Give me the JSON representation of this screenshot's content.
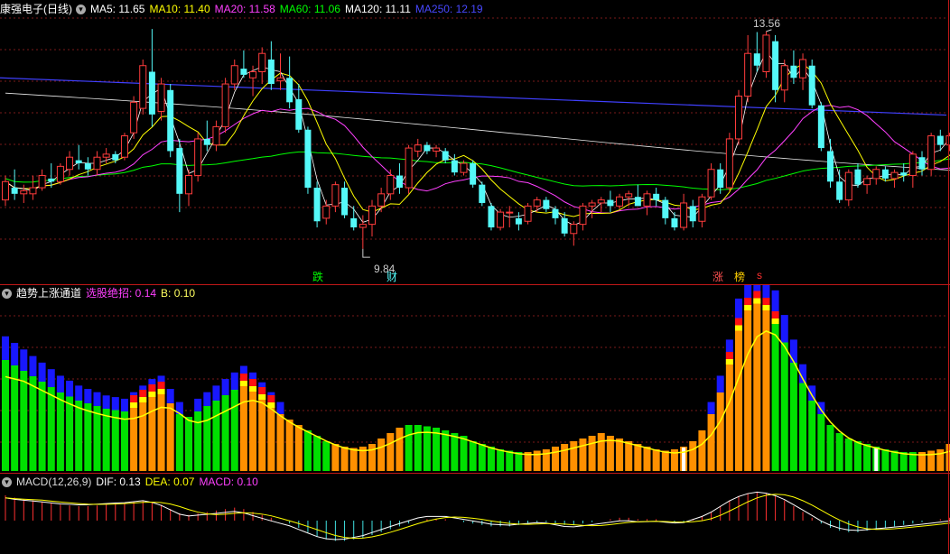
{
  "colors": {
    "up": "#ff3c3c",
    "down": "#54f8f8",
    "ma5": "#ffffff",
    "ma10": "#ffff00",
    "ma20": "#ff40ff",
    "ma60": "#00ff00",
    "ma120": "#ffffff",
    "ma250": "#4040ff",
    "grid": "#7a1a1a",
    "sep": "#c01818"
  },
  "top": {
    "icon": "chevron-down-icon",
    "stock": "康强电子(日线)",
    "ma5": "MA5: 11.65",
    "ma10": "MA10: 11.40",
    "ma20": "MA20: 11.58",
    "ma60": "MA60: 11.06",
    "ma120": "MA120: 11.11",
    "ma250": "MA250: 12.19",
    "high_label": "13.56",
    "low_label": "9.84",
    "markers": {
      "die": "跌",
      "cai": "财",
      "zhang": "涨",
      "bang": "榜",
      "s": "s"
    }
  },
  "mid": {
    "icon": "chevron-down-icon",
    "name": "趋势上涨通道",
    "v1": "选股绝招: 0.14",
    "v2": "B: 0.10"
  },
  "bottom": {
    "icon": "chevron-down-icon",
    "name": "MACD(12,26,9)",
    "dif": "DIF: 0.13",
    "dea": "DEA: 0.07",
    "macd": "MACD: 0.10"
  },
  "chart_data": {
    "type": "candlestick",
    "candles": [
      [
        10.8,
        11.2,
        10.7,
        11.1
      ],
      [
        11.0,
        11.3,
        10.8,
        10.9
      ],
      [
        10.9,
        11.05,
        10.75,
        10.95
      ],
      [
        10.9,
        11.2,
        10.8,
        11.0
      ],
      [
        11.0,
        11.3,
        10.95,
        11.2
      ],
      [
        11.15,
        11.4,
        11.0,
        11.1
      ],
      [
        11.1,
        11.4,
        11.05,
        11.35
      ],
      [
        11.3,
        11.6,
        11.2,
        11.5
      ],
      [
        11.45,
        11.7,
        11.3,
        11.4
      ],
      [
        11.4,
        11.5,
        11.2,
        11.3
      ],
      [
        11.3,
        11.6,
        11.2,
        11.5
      ],
      [
        11.5,
        11.65,
        11.4,
        11.55
      ],
      [
        11.55,
        11.6,
        11.4,
        11.45
      ],
      [
        11.5,
        11.9,
        11.45,
        11.85
      ],
      [
        11.9,
        12.5,
        11.8,
        12.4
      ],
      [
        12.3,
        13.1,
        12.2,
        13.0
      ],
      [
        12.9,
        13.6,
        12.0,
        12.2
      ],
      [
        12.25,
        12.8,
        12.1,
        12.7
      ],
      [
        12.6,
        12.7,
        11.5,
        11.6
      ],
      [
        11.65,
        11.8,
        10.6,
        10.9
      ],
      [
        10.9,
        11.3,
        10.7,
        11.2
      ],
      [
        11.2,
        11.9,
        11.1,
        11.8
      ],
      [
        11.8,
        12.1,
        11.6,
        11.7
      ],
      [
        11.7,
        12.1,
        11.6,
        12.0
      ],
      [
        12.0,
        12.8,
        11.9,
        12.7
      ],
      [
        12.7,
        13.1,
        12.6,
        13.0
      ],
      [
        12.95,
        13.25,
        12.8,
        12.85
      ],
      [
        12.8,
        13.0,
        12.5,
        12.9
      ],
      [
        12.9,
        13.3,
        12.7,
        13.2
      ],
      [
        13.1,
        13.4,
        12.6,
        12.7
      ],
      [
        12.75,
        13.2,
        12.6,
        12.8
      ],
      [
        12.8,
        13.15,
        12.3,
        12.4
      ],
      [
        12.45,
        12.7,
        11.9,
        11.95
      ],
      [
        11.95,
        12.0,
        10.9,
        11.0
      ],
      [
        11.0,
        11.1,
        10.35,
        10.45
      ],
      [
        10.5,
        10.8,
        10.4,
        10.7
      ],
      [
        10.7,
        11.1,
        10.6,
        11.05
      ],
      [
        11.0,
        11.1,
        10.5,
        10.55
      ],
      [
        10.5,
        10.7,
        10.3,
        10.35
      ],
      [
        10.35,
        10.55,
        10.0,
        10.4
      ],
      [
        10.4,
        10.8,
        10.2,
        10.7
      ],
      [
        10.7,
        11.0,
        10.6,
        10.9
      ],
      [
        10.9,
        11.3,
        10.8,
        11.2
      ],
      [
        11.2,
        11.4,
        10.9,
        11.0
      ],
      [
        11.0,
        11.7,
        10.9,
        11.65
      ],
      [
        11.6,
        11.8,
        11.5,
        11.7
      ],
      [
        11.7,
        11.75,
        11.55,
        11.6
      ],
      [
        11.6,
        11.7,
        11.5,
        11.65
      ],
      [
        11.6,
        11.65,
        11.4,
        11.45
      ],
      [
        11.45,
        11.55,
        11.2,
        11.25
      ],
      [
        11.25,
        11.45,
        11.2,
        11.4
      ],
      [
        11.4,
        11.45,
        11.0,
        11.05
      ],
      [
        11.05,
        11.1,
        10.7,
        10.75
      ],
      [
        10.7,
        10.75,
        10.3,
        10.35
      ],
      [
        10.35,
        10.65,
        10.3,
        10.6
      ],
      [
        10.6,
        10.7,
        10.35,
        10.6
      ],
      [
        10.5,
        10.6,
        10.3,
        10.4
      ],
      [
        10.45,
        10.75,
        10.4,
        10.7
      ],
      [
        10.7,
        10.85,
        10.6,
        10.8
      ],
      [
        10.8,
        10.85,
        10.6,
        10.65
      ],
      [
        10.65,
        10.7,
        10.4,
        10.5
      ],
      [
        10.5,
        10.6,
        10.2,
        10.25
      ],
      [
        10.25,
        10.45,
        10.05,
        10.4
      ],
      [
        10.4,
        10.75,
        10.3,
        10.7
      ],
      [
        10.7,
        10.8,
        10.5,
        10.75
      ],
      [
        10.75,
        10.85,
        10.6,
        10.8
      ],
      [
        10.8,
        10.95,
        10.6,
        10.7
      ],
      [
        10.7,
        10.9,
        10.65,
        10.85
      ],
      [
        10.85,
        10.95,
        10.7,
        10.9
      ],
      [
        10.85,
        11.05,
        10.75,
        10.7
      ],
      [
        10.7,
        10.95,
        10.55,
        10.9
      ],
      [
        10.9,
        11.0,
        10.7,
        10.8
      ],
      [
        10.8,
        10.85,
        10.4,
        10.5
      ],
      [
        10.5,
        10.6,
        10.3,
        10.35
      ],
      [
        10.35,
        10.9,
        10.3,
        10.75
      ],
      [
        10.7,
        10.8,
        10.35,
        10.45
      ],
      [
        10.45,
        10.9,
        10.35,
        10.85
      ],
      [
        10.85,
        11.4,
        10.8,
        11.3
      ],
      [
        11.3,
        11.4,
        10.9,
        11.0
      ],
      [
        11.0,
        11.9,
        10.95,
        11.8
      ],
      [
        11.8,
        12.6,
        11.7,
        12.5
      ],
      [
        12.5,
        13.5,
        12.4,
        13.2
      ],
      [
        13.2,
        13.55,
        12.9,
        13.0
      ],
      [
        12.9,
        13.56,
        12.8,
        13.5
      ],
      [
        13.4,
        13.5,
        12.4,
        12.6
      ],
      [
        12.6,
        13.1,
        12.4,
        13.0
      ],
      [
        13.0,
        13.25,
        12.7,
        12.8
      ],
      [
        12.8,
        13.2,
        12.6,
        13.1
      ],
      [
        13.0,
        13.1,
        12.3,
        12.35
      ],
      [
        12.35,
        12.4,
        11.6,
        11.65
      ],
      [
        11.6,
        11.8,
        11.0,
        11.1
      ],
      [
        11.1,
        11.3,
        10.75,
        10.8
      ],
      [
        10.8,
        11.3,
        10.7,
        11.25
      ],
      [
        11.3,
        11.4,
        11.0,
        11.05
      ],
      [
        11.05,
        11.2,
        10.9,
        11.15
      ],
      [
        11.15,
        11.35,
        11.05,
        11.3
      ],
      [
        11.3,
        11.35,
        11.1,
        11.15
      ],
      [
        11.15,
        11.3,
        11.0,
        11.25
      ],
      [
        11.25,
        11.4,
        11.1,
        11.2
      ],
      [
        11.2,
        11.6,
        11.0,
        11.55
      ],
      [
        11.5,
        11.6,
        11.2,
        11.3
      ],
      [
        11.3,
        11.9,
        11.2,
        11.85
      ],
      [
        11.85,
        11.95,
        11.6,
        11.7
      ],
      [
        11.7,
        11.9,
        11.6,
        11.85
      ],
      [
        11.85,
        12.5,
        11.8,
        12.4
      ],
      [
        12.4,
        12.7,
        12.2,
        12.6
      ]
    ],
    "ma250": [
      12.8,
      12.19
    ],
    "osc": [
      0.82,
      0.78,
      0.74,
      0.7,
      0.66,
      0.62,
      0.58,
      0.55,
      0.52,
      0.5,
      0.48,
      0.46,
      0.45,
      0.44,
      0.48,
      0.52,
      0.56,
      0.58,
      0.5,
      0.42,
      0.4,
      0.44,
      0.48,
      0.52,
      0.56,
      0.6,
      0.64,
      0.6,
      0.54,
      0.48,
      0.42,
      0.38,
      0.34,
      0.3,
      0.26,
      0.22,
      0.2,
      0.18,
      0.17,
      0.18,
      0.2,
      0.24,
      0.28,
      0.32,
      0.34,
      0.34,
      0.33,
      0.32,
      0.3,
      0.28,
      0.26,
      0.22,
      0.2,
      0.18,
      0.16,
      0.15,
      0.14,
      0.14,
      0.15,
      0.16,
      0.18,
      0.2,
      0.22,
      0.24,
      0.26,
      0.28,
      0.26,
      0.24,
      0.22,
      0.2,
      0.18,
      0.16,
      0.15,
      0.16,
      0.18,
      0.22,
      0.3,
      0.42,
      0.58,
      0.8,
      1.05,
      1.2,
      1.25,
      1.2,
      1.1,
      0.95,
      0.8,
      0.65,
      0.52,
      0.42,
      0.34,
      0.28,
      0.24,
      0.22,
      0.2,
      0.18,
      0.16,
      0.15,
      0.14,
      0.14,
      0.14,
      0.15,
      0.16,
      0.2,
      0.28,
      0.36
    ],
    "macd": [
      0.35,
      0.32,
      0.3,
      0.28,
      0.26,
      0.24,
      0.22,
      0.21,
      0.2,
      0.2,
      0.21,
      0.22,
      0.23,
      0.24,
      0.26,
      0.28,
      0.26,
      0.22,
      0.16,
      0.1,
      0.08,
      0.1,
      0.12,
      0.14,
      0.16,
      0.18,
      0.16,
      0.12,
      0.08,
      0.04,
      0.0,
      -0.04,
      -0.1,
      -0.16,
      -0.22,
      -0.26,
      -0.28,
      -0.28,
      -0.26,
      -0.24,
      -0.2,
      -0.16,
      -0.12,
      -0.08,
      -0.04,
      0.0,
      0.02,
      0.02,
      0.02,
      0.0,
      -0.02,
      -0.04,
      -0.06,
      -0.08,
      -0.08,
      -0.08,
      -0.06,
      -0.04,
      -0.02,
      -0.02,
      -0.04,
      -0.06,
      -0.06,
      -0.04,
      -0.02,
      0.0,
      0.02,
      0.04,
      0.04,
      0.02,
      0.02,
      0.02,
      0.0,
      -0.02,
      -0.02,
      0.02,
      0.06,
      0.12,
      0.2,
      0.28,
      0.34,
      0.38,
      0.4,
      0.38,
      0.34,
      0.28,
      0.2,
      0.12,
      0.04,
      -0.04,
      -0.1,
      -0.14,
      -0.16,
      -0.16,
      -0.14,
      -0.12,
      -0.1,
      -0.08,
      -0.06,
      -0.04,
      -0.02,
      0.0,
      0.02,
      0.04,
      0.08,
      0.1
    ]
  }
}
